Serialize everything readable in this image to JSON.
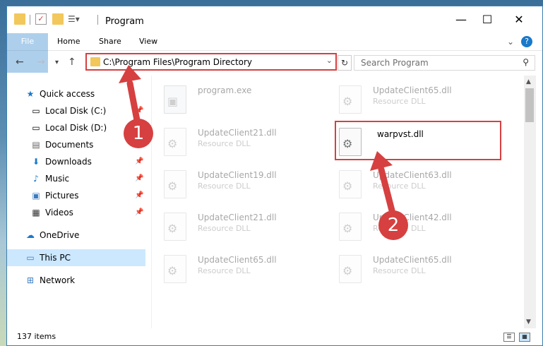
{
  "window": {
    "title": "Program",
    "minimize": "—",
    "maximize": "☐",
    "close": "✕",
    "help": "?",
    "chevron": "⌄"
  },
  "ribbon": {
    "tabs": [
      "File",
      "Home",
      "Share",
      "View"
    ]
  },
  "address": {
    "path": "C:\\Program Files\\Program Directory",
    "search_placeholder": "Search Program"
  },
  "nav": {
    "quick_access": "Quick access",
    "items": [
      {
        "label": "Local Disk (C:)",
        "icon": "drive-icon",
        "pinned": true
      },
      {
        "label": "Local Disk (D:)",
        "icon": "drive-icon",
        "pinned": false
      },
      {
        "label": "Documents",
        "icon": "documents-icon",
        "pinned": true
      },
      {
        "label": "Downloads",
        "icon": "downloads-icon",
        "pinned": true
      },
      {
        "label": "Music",
        "icon": "music-icon",
        "pinned": true
      },
      {
        "label": "Pictures",
        "icon": "pictures-icon",
        "pinned": true
      },
      {
        "label": "Videos",
        "icon": "videos-icon",
        "pinned": true
      }
    ],
    "onedrive": "OneDrive",
    "thispc": "This PC",
    "network": "Network"
  },
  "files": [
    {
      "name": "program.exe",
      "type": ""
    },
    {
      "name": "UpdateClient65.dll",
      "type": "Resource DLL"
    },
    {
      "name": "UpdateClient21.dll",
      "type": "Resource DLL"
    },
    {
      "name": "warpvst.dll",
      "type": ""
    },
    {
      "name": "UpdateClient19.dll",
      "type": "Resource DLL"
    },
    {
      "name": "UpdateClient63.dll",
      "type": "Resource DLL"
    },
    {
      "name": "UpdateClient21.dll",
      "type": "Resource DLL"
    },
    {
      "name": "UpdateClient42.dll",
      "type": "Resource DLL"
    },
    {
      "name": "UpdateClient65.dll",
      "type": "Resource DLL"
    },
    {
      "name": "UpdateClient65.dll",
      "type": "Resource DLL"
    }
  ],
  "status": {
    "count": "137 items"
  },
  "callouts": [
    "1",
    "2"
  ],
  "colors": {
    "accent": "#1979ca",
    "highlight": "#d64040"
  }
}
